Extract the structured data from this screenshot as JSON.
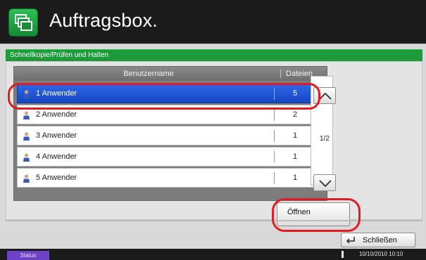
{
  "window": {
    "title": "Auftragsbox.",
    "icon": "job-box-icon"
  },
  "section": {
    "label": "Schnellkopie/Prüfen und Halten"
  },
  "table": {
    "columns": [
      "Benutzername",
      "Dateien"
    ],
    "rows": [
      {
        "name": "1 Anwender",
        "files": "5",
        "selected": true
      },
      {
        "name": "2 Anwender",
        "files": "2",
        "selected": false
      },
      {
        "name": "3 Anwender",
        "files": "1",
        "selected": false
      },
      {
        "name": "4 Anwender",
        "files": "1",
        "selected": false
      },
      {
        "name": "5 Anwender",
        "files": "1",
        "selected": false
      }
    ]
  },
  "pager": {
    "page_indicator": "1/2",
    "up_icon": "chevron-up-icon",
    "down_icon": "chevron-down-icon"
  },
  "buttons": {
    "open": "Öffnen",
    "close": "Schließen"
  },
  "statusbar": {
    "status": "Status",
    "datetime": "10/10/2010  10:10"
  },
  "colors": {
    "accent_green": "#1f9a3a",
    "selection_blue": "#1f55d6",
    "highlight_red": "#e01b22",
    "status_purple": "#6e42c7"
  }
}
